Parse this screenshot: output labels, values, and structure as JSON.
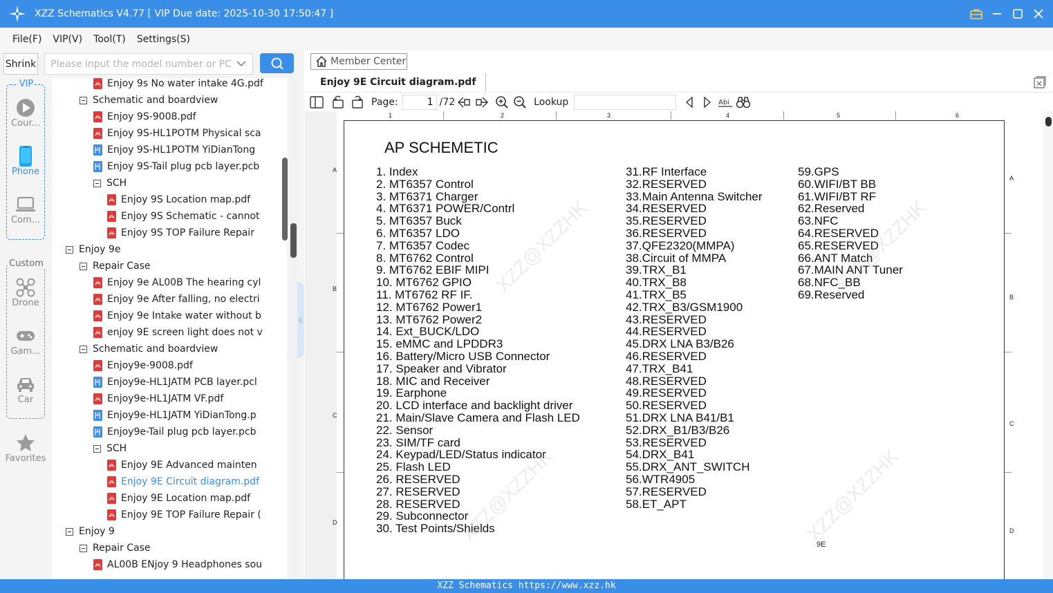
{
  "window": {
    "title": "XZZ Schematics V4.77 [ VIP Due date: 2025-10-30 17:50:47 ]",
    "accent_color": "#3b8ee8"
  },
  "menu": [
    "File(F)",
    "VIP(V)",
    "Tool(T)",
    "Settings(S)"
  ],
  "search": {
    "shrink_label": "Shrink",
    "placeholder": "Please input the model number or PCB"
  },
  "categories": {
    "vip_legend": "VIP",
    "custom_legend": "Custom",
    "items": [
      "Cour...",
      "Phone",
      "Com...",
      "Drone",
      "Gam...",
      "Car",
      "Favorites"
    ],
    "active": "Phone"
  },
  "tree": [
    {
      "text": "Enjoy 9s No water intake 4G.pdf",
      "icon": "pdf"
    },
    {
      "text": "Schematic and boardview",
      "icon": "folder"
    },
    {
      "text": "Enjoy 9S-9008.pdf",
      "icon": "pdf"
    },
    {
      "text": "Enjoy 9S-HL1POTM Physical sca",
      "icon": "pdf"
    },
    {
      "text": "Enjoy 9S-HL1POTM YiDianTong",
      "icon": "pcb"
    },
    {
      "text": "Enjoy 9S-Tail plug pcb layer.pcb",
      "icon": "pcb"
    },
    {
      "text": "SCH",
      "icon": "folder"
    },
    {
      "text": "Enjoy 9S Location map.pdf",
      "icon": "pdf"
    },
    {
      "text": "Enjoy 9S Schematic - cannot",
      "icon": "pdf"
    },
    {
      "text": "Enjoy 9S TOP  Failure Repair",
      "icon": "pdf"
    },
    {
      "text": "Enjoy 9e",
      "icon": "folder"
    },
    {
      "text": "Repair Case",
      "icon": "folder"
    },
    {
      "text": "Enjoy 9e AL00B The hearing cyl",
      "icon": "pdf"
    },
    {
      "text": "Enjoy 9e After falling, no electri",
      "icon": "pdf"
    },
    {
      "text": "Enjoy 9e Intake water without b",
      "icon": "pdf"
    },
    {
      "text": "enjoy 9E screen light does not v",
      "icon": "pdf"
    },
    {
      "text": "Schematic and boardview",
      "icon": "folder"
    },
    {
      "text": "Enjoy9e-9008.pdf",
      "icon": "pdf"
    },
    {
      "text": "Enjoy9e-HL1JATM PCB layer.pcl",
      "icon": "pcb"
    },
    {
      "text": "Enjoy9e-HL1JATM VF.pdf",
      "icon": "pdf"
    },
    {
      "text": "Enjoy9e-HL1JATM YiDianTong.p",
      "icon": "pcb"
    },
    {
      "text": "Enjoy9e-Tail plug pcb layer.pcb",
      "icon": "pcb"
    },
    {
      "text": "SCH",
      "icon": "folder"
    },
    {
      "text": "Enjoy 9E Advanced mainten",
      "icon": "pdf"
    },
    {
      "text": "Enjoy 9E Circuit diagram.pdf",
      "icon": "pdf"
    },
    {
      "text": "Enjoy 9E Location map.pdf",
      "icon": "pdf"
    },
    {
      "text": "Enjoy 9E TOP Failure Repair (",
      "icon": "pdf"
    },
    {
      "text": "Enjoy 9",
      "icon": "folder"
    },
    {
      "text": "Repair Case",
      "icon": "folder"
    },
    {
      "text": "AL00B ENjoy 9 Headphones sou",
      "icon": "pdf"
    }
  ],
  "viewer": {
    "member_center": "Member Center",
    "tab_title": "Enjoy 9E Circuit diagram.pdf",
    "page_label": "Page:",
    "page_current": "1",
    "page_total": "/72",
    "lookup_label": "Lookup"
  },
  "document": {
    "title": "AP SCHEMETIC",
    "column1": [
      "1. Index",
      "2. MT6357 Control",
      "3. MT6371 Charger",
      "4. MT6371 POWER/Contrl",
      "5. MT6357 Buck",
      "6. MT6357 LDO",
      "7. MT6357 Codec",
      "8. MT6762 Control",
      "9. MT6762 EBIF MIPI",
      "10. MT6762 GPIO",
      "11. MT6762 RF IF.",
      "12. MT6762 Power1",
      "13. MT6762 Power2",
      "14. Ext_BUCK/LDO",
      "15. eMMC and LPDDR3",
      "16. Battery/Micro USB Connector",
      "17. Speaker and Vibrator",
      "18. MIC and Receiver",
      "19. Earphone",
      "20. LCD interface and backlight driver",
      "21. Main/Slave Camera and Flash LED",
      "22. Sensor",
      "23. SIM/TF card",
      "24. Keypad/LED/Status indicator",
      "25. Flash LED",
      "26. RESERVED",
      "27. RESERVED",
      "28. RESERVED",
      "29. Subconnector",
      "30. Test Points/Shields"
    ],
    "column2": [
      "31.RF Interface",
      "32.RESERVED",
      "33.Main Antenna Switcher",
      "34.RESERVED",
      "35.RESERVED",
      "36.RESERVED",
      "37.QFE2320(MMPA)",
      "38.Circuit of MMPA",
      "39.TRX_B1",
      "40.TRX_B8",
      "41.TRX_B5",
      "42.TRX_B3/GSM1900",
      "43.RESERVED",
      "44.RESERVED",
      "45.DRX LNA B3/B26",
      "46.RESERVED",
      "47.TRX_B41",
      "48.RESERVED",
      "49.RESERVED",
      "50.RESERVED",
      "51.DRX LNA B41/B1",
      "52.DRX_B1/B3/B26",
      "53.RESERVED",
      "54.DRX_B41",
      "55.DRX_ANT_SWITCH",
      "56.WTR4905",
      "57.RESERVED",
      "58.ET_APT"
    ],
    "column3": [
      "59.GPS",
      "60.WIFI/BT BB",
      "61.WIFI/BT RF",
      "62.Reserved",
      "63.NFC",
      "64.RESERVED",
      "65.RESERVED",
      "66.ANT Match",
      "67.MAIN ANT Tuner",
      "68.NFC_BB",
      "69.Reserved"
    ],
    "zone_numbers": [
      "1",
      "2",
      "3",
      "4",
      "5",
      "6"
    ],
    "zone_letters": [
      "A",
      "B",
      "C",
      "D"
    ],
    "page_label": "9E",
    "watermark": "XZZ@XZZHK"
  },
  "statusbar": "XZZ Schematics https://www.xzz.hk"
}
